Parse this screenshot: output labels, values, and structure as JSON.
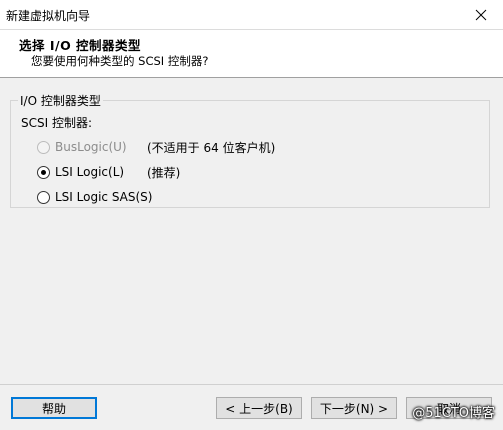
{
  "window": {
    "title": "新建虚拟机向导"
  },
  "header": {
    "title": "选择 I/O 控制器类型",
    "subtitle": "您要使用何种类型的 SCSI 控制器?"
  },
  "group": {
    "label": "I/O 控制器类型",
    "field_label": "SCSI 控制器:",
    "options": [
      {
        "label": "BusLogic(U)",
        "note": "(不适用于 64 位客户机)",
        "checked": false,
        "disabled": true
      },
      {
        "label": "LSI Logic(L)",
        "note": "(推荐)",
        "checked": true,
        "disabled": false
      },
      {
        "label": "LSI Logic SAS(S)",
        "note": "",
        "checked": false,
        "disabled": false
      }
    ]
  },
  "footer": {
    "help": "帮助",
    "back": "< 上一步(B)",
    "next": "下一步(N) >",
    "cancel": "取消"
  },
  "watermark": "@51CTO博客"
}
